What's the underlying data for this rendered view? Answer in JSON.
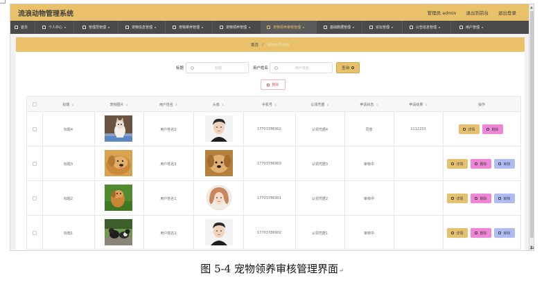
{
  "app": {
    "title": "流浪动物管理系统",
    "user": "管理员 admin",
    "links": [
      "退出到前台",
      "退出登录"
    ]
  },
  "nav": [
    {
      "label": "首页",
      "icon": "home-icon"
    },
    {
      "label": "个人中心",
      "icon": "user-icon"
    },
    {
      "label": "管理员管理",
      "icon": "admin-icon"
    },
    {
      "label": "宠物信息管理",
      "icon": "paw-icon"
    },
    {
      "label": "宠物寄养管理",
      "icon": "home-icon"
    },
    {
      "label": "宠物领养管理",
      "icon": "clipboard-icon"
    },
    {
      "label": "宠物领养审核管理",
      "icon": "check-icon",
      "active": true
    },
    {
      "label": "基础数据管理",
      "icon": "database-icon"
    },
    {
      "label": "论坛管理",
      "icon": "forum-icon"
    },
    {
      "label": "公告信息管理",
      "icon": "notice-icon"
    },
    {
      "label": "用户管理",
      "icon": "users-icon"
    }
  ],
  "breadcrumb": {
    "home": "首页",
    "sep": "/",
    "current": "宠物领养审核"
  },
  "search": {
    "title_label": "标题",
    "title_placeholder": "标题",
    "name_label": "用户姓名",
    "name_placeholder": "用户姓名",
    "button": "查询"
  },
  "delete_button": "删除",
  "table": {
    "headers": [
      "标题",
      "宠物图片",
      "用户姓名",
      "头像",
      "手机号",
      "认领凭据",
      "申请状态",
      "申请结果",
      "操作"
    ],
    "rows": [
      {
        "title": "标题4",
        "pet": "cat",
        "name": "用户姓名2",
        "avatar": "male",
        "phone": "17703786902",
        "proof": "认领凭据4",
        "status": "同意",
        "result": "1112233",
        "actions": [
          "详情",
          "删除"
        ]
      },
      {
        "title": "标题3",
        "pet": "golden",
        "name": "用户姓名3",
        "avatar": "puppy",
        "phone": "17703786903",
        "proof": "认领凭据3",
        "status": "审核中",
        "result": "",
        "actions": [
          "详情",
          "删除",
          "审核"
        ]
      },
      {
        "title": "标题2",
        "pet": "dog-grass",
        "name": "用户姓名1",
        "avatar": "female",
        "phone": "17703786901",
        "proof": "认领凭据2",
        "status": "审核中",
        "result": "",
        "actions": [
          "详情",
          "删除",
          "审核"
        ]
      },
      {
        "title": "标题1",
        "pet": "dogs-park",
        "name": "用户姓名2",
        "avatar": "male",
        "phone": "17703786902",
        "proof": "认领凭据1",
        "status": "审核中",
        "result": "",
        "actions": [
          "详情",
          "删除",
          "审核"
        ]
      }
    ]
  },
  "colors": {
    "accent": "#e8c16a",
    "nav_bg": "#4a4a4a",
    "detail_btn": "#e5c06f",
    "delete_btn": "#ef86d6",
    "review_btn": "#aebcf2",
    "page_active": "#26b08d"
  },
  "caption": "图 5-4 宠物领养审核管理界面"
}
